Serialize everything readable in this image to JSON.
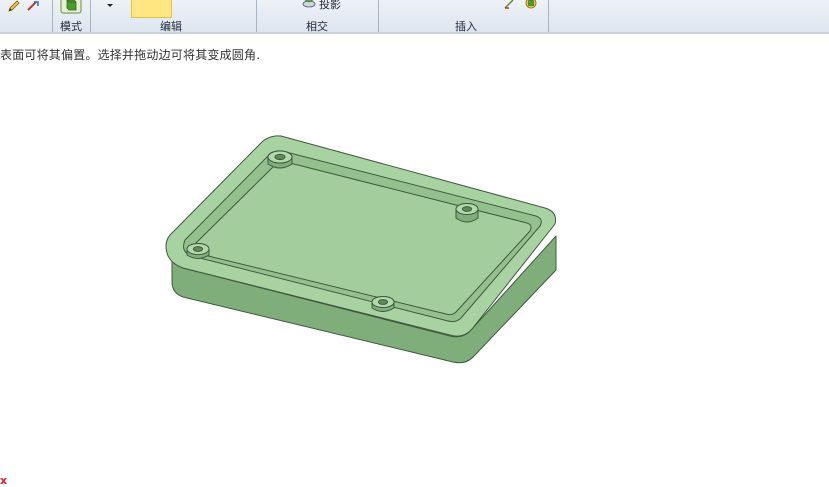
{
  "ribbon": {
    "groups": [
      {
        "label": "模式"
      },
      {
        "label": "编辑"
      },
      {
        "label": "相交"
      },
      {
        "label": "插入"
      }
    ],
    "project_label": "投影"
  },
  "status": {
    "hint": "表面可将其偏置。选择并拖动边可将其变成圆角."
  },
  "viewport": {
    "part_color": "#9fc89a",
    "edge_color": "#3f5a3f",
    "triad_label": "x"
  },
  "colors": {
    "ribbon_bg": "#e4ebf3",
    "accent": "#ffe680"
  }
}
